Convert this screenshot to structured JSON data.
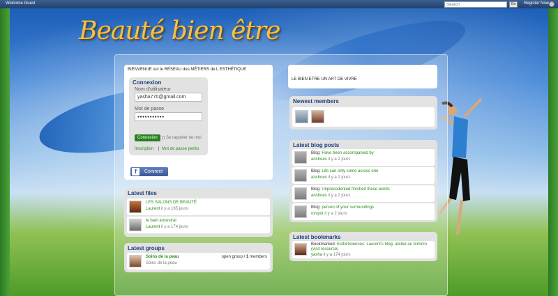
{
  "topbar": {
    "welcome": "Welcome Guest",
    "search_placeholder": "Search",
    "go": "Go",
    "register": "Register Now"
  },
  "logo": "Beauté bien être",
  "welcome_text": "BIENVENUE sur le RÉSEAU des MÉTIERS de L ESTHÉTIQUE",
  "login": {
    "title": "Connexion",
    "username_label": "Nom d'utilisateur",
    "username_value": "yasha770@gmail.com",
    "password_label": "Mot de passe",
    "password_value": "●●●●●●●●●●●",
    "submit": "Connexion",
    "remember": "Se rappeler de moi",
    "register_link": "Inscription",
    "separator": "|",
    "forgot_link": "Mot de passe perdu"
  },
  "facebook": {
    "icon": "f",
    "label": "Connect"
  },
  "tagline": "LE BIEN ETRE  UN ART DE VIVRE",
  "newest_members": {
    "title": "Newest members"
  },
  "latest_files": {
    "title": "Latest files",
    "items": [
      {
        "title": "LES SALONS DE BEAUTÉ",
        "author": "Laurent",
        "time": "il y a 165 jours"
      },
      {
        "title": "le bain ancestral",
        "author": "Laurent",
        "time": "il y a 174 jours"
      }
    ]
  },
  "latest_groups": {
    "title": "Latest groups",
    "items": [
      {
        "title": "Soins de la peau",
        "desc": "Soins de la peau",
        "type": "open group /",
        "count": "1",
        "count_label": "members"
      }
    ]
  },
  "latest_blog": {
    "title": "Latest blog posts",
    "prefix": "Blog:",
    "items": [
      {
        "title": "Have been accompanied by",
        "author": "anshoes",
        "time": "il y a 2 jours"
      },
      {
        "title": "Life can only come across one",
        "author": "anshoes",
        "time": "il y a 2 jours"
      },
      {
        "title": "Unprecedented finished these words",
        "author": "anshoes",
        "time": "il y a 2 jours"
      },
      {
        "title": "person of your surroundings",
        "author": "ovspot",
        "time": "il y a 2 jours"
      }
    ]
  },
  "latest_bookmarks": {
    "title": "Latest bookmarks",
    "items": [
      {
        "prefix": "Bookmarked:",
        "title": "Esthéticiennes: Laurent's blog: atelier au feminin",
        "extra": "(visit resource)",
        "author": "yasha",
        "time": "il y a 174 jours"
      }
    ]
  }
}
